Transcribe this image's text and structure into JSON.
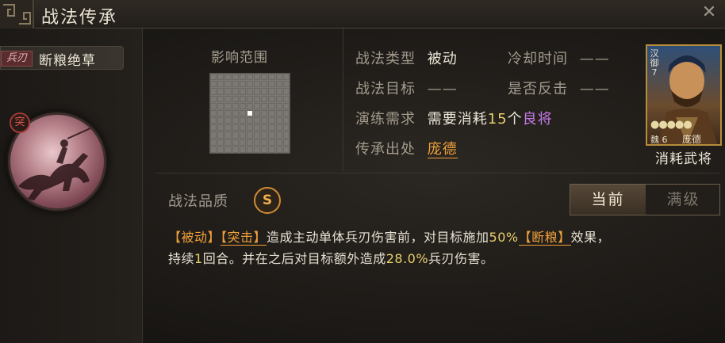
{
  "header": {
    "title": "战法传承"
  },
  "skill": {
    "type_tag": "兵刃",
    "name": "断粮绝草",
    "medal_badge": "突"
  },
  "range": {
    "label": "影响范围",
    "grid_size": 11,
    "active_cell": [
      5,
      5
    ]
  },
  "info": {
    "skill_type_label": "战法类型",
    "skill_type_value": "被动",
    "cooldown_label": "冷却时间",
    "cooldown_value": "——",
    "target_label": "战法目标",
    "target_value": "——",
    "counter_label": "是否反击",
    "counter_value": "——",
    "practice_label": "演练需求",
    "practice_prefix": "需要消耗",
    "practice_count": "15",
    "practice_unit": "个",
    "practice_item": "良将",
    "source_label": "传承出处",
    "source_value": "庞德"
  },
  "hero": {
    "camp": "汉",
    "troop": "御",
    "cost": "7",
    "stars": "●●●●●",
    "faction": "魏",
    "level": "6",
    "name": "庞德",
    "caption": "消耗武将"
  },
  "quality": {
    "label": "战法品质",
    "grade": "S"
  },
  "toggle": {
    "current": "当前",
    "max": "满级"
  },
  "description": {
    "tag1": "【被动】",
    "tag2": "【突击】",
    "part1": "造成主动单体兵刃伤害前，对目标施加",
    "pct1": "50%",
    "tag3": "【断粮】",
    "part2": "效果，",
    "part3": "持续",
    "rounds": "1",
    "part4": "回合。并在之后对目标额外造成",
    "pct2": "28.0%",
    "part5": "兵刃伤害。"
  },
  "colors": {
    "accent": "#f0a13a",
    "purple": "#c679e8",
    "text": "#ece5d6",
    "label": "#a39b8d"
  }
}
